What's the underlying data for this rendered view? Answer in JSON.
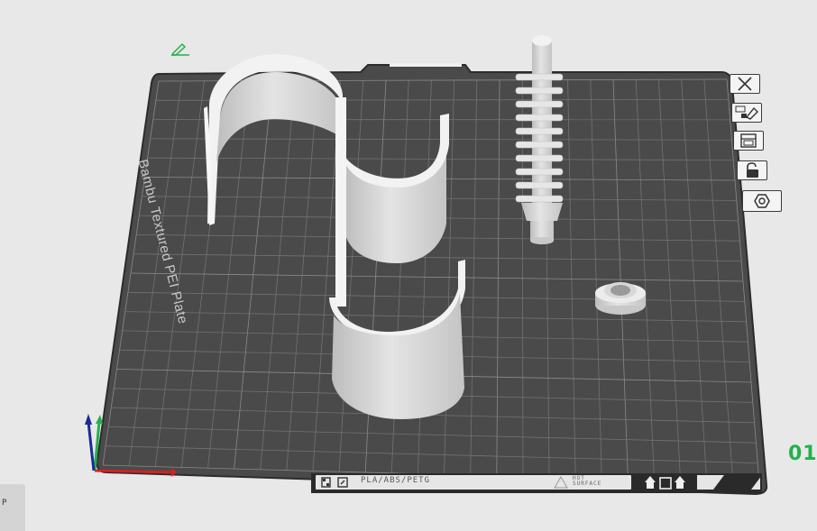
{
  "plate": {
    "name": "Bambu Textured PEI Plate",
    "number": "01",
    "materials": "PLA/ABS/PETG",
    "surface_line1": "HOT",
    "surface_line2": "SURFACE"
  },
  "side_tab": {
    "label": "P"
  },
  "toolbar": {
    "buttons": [
      {
        "icon": "close-icon"
      },
      {
        "icon": "auto-orient-icon"
      },
      {
        "icon": "arrange-icon"
      },
      {
        "icon": "lock-icon"
      },
      {
        "icon": "settings-hex-icon"
      }
    ]
  },
  "colors": {
    "plate": "#4a4a4a",
    "grid": "#6e6e6e",
    "model": "#d4d4d4",
    "accent": "#22b14c",
    "axis_x": "#d62020",
    "axis_y": "#22b14c",
    "axis_z": "#1a2a9a"
  }
}
